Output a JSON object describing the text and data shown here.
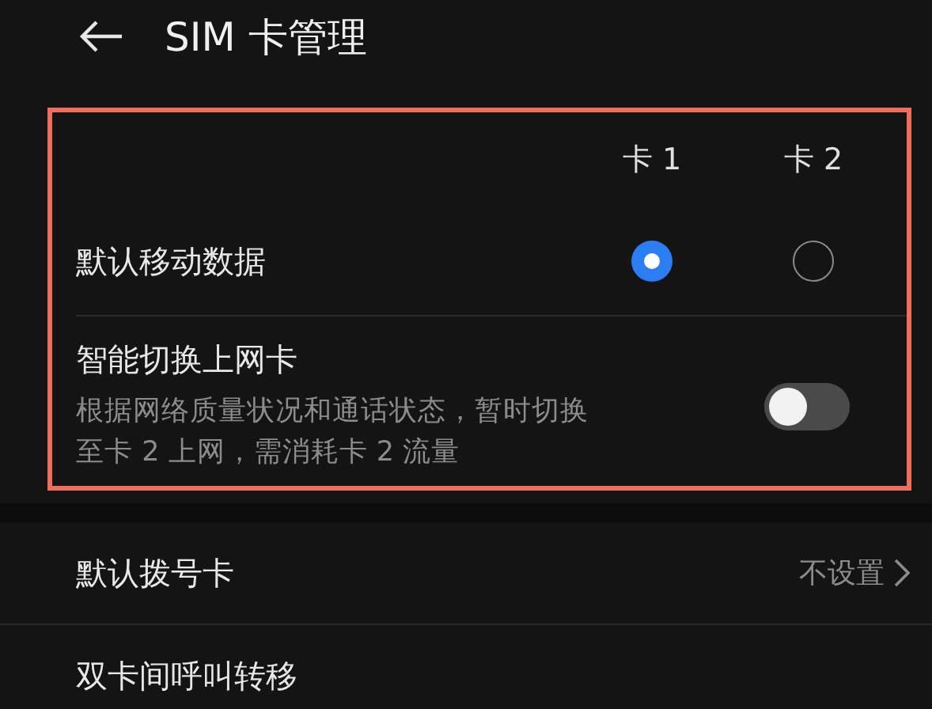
{
  "header": {
    "title": "SIM 卡管理"
  },
  "card_columns": [
    "卡 1",
    "卡 2"
  ],
  "data_sim": {
    "label": "默认移动数据",
    "options": [
      {
        "selected": true
      },
      {
        "selected": false
      }
    ]
  },
  "smart_switch": {
    "label": "智能切换上网卡",
    "description_lines": [
      "根据网络质量状况和通话状态，暂时切换",
      "至卡 2 上网，需消耗卡 2 流量"
    ],
    "on": false
  },
  "settings": [
    {
      "label": "默认拨号卡",
      "value": "不设置"
    },
    {
      "label": "双卡间呼叫转移"
    }
  ]
}
